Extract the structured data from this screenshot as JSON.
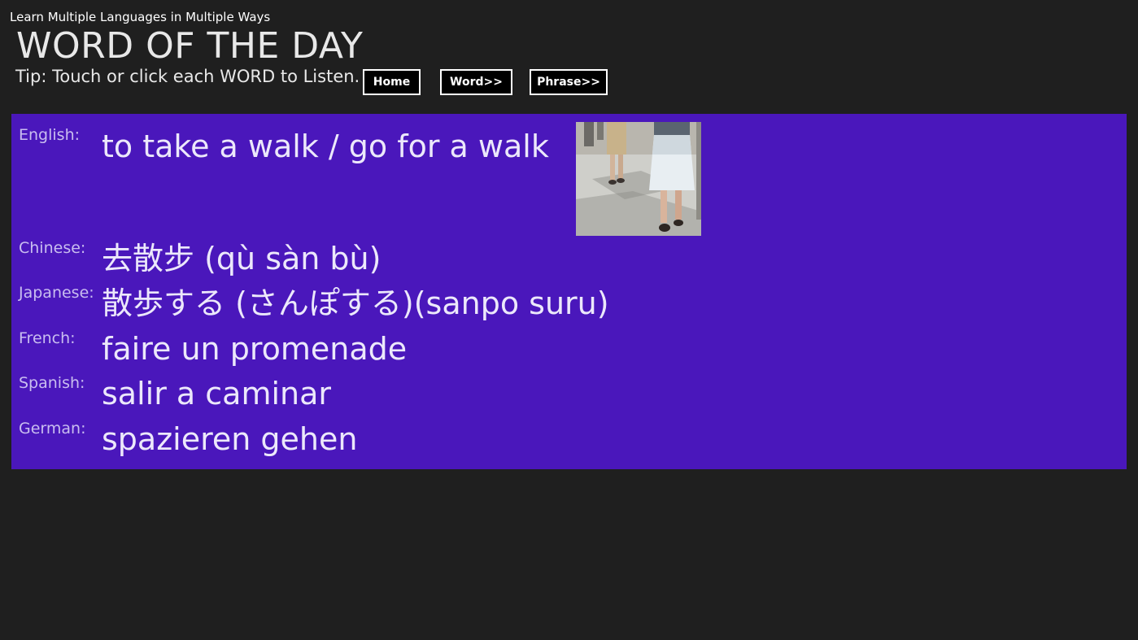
{
  "app": {
    "title": "Learn Multiple Languages in Multiple Ways"
  },
  "header": {
    "title": "WORD OF THE DAY",
    "tip": "Tip: Touch or click each WORD to Listen."
  },
  "nav": {
    "home_label": "Home",
    "word_label": "Word>>",
    "phrase_label": "Phrase>>"
  },
  "word": {
    "rows": [
      {
        "label": "English:",
        "value": "to take a walk / go for a walk"
      },
      {
        "label": "Chinese:",
        "value": "去散步 (qù sàn bù)"
      },
      {
        "label": "Japanese:",
        "value": "散歩する (さんぽする)(sanpo suru)"
      },
      {
        "label": "French:",
        "value": "faire un promenade"
      },
      {
        "label": "Spanish:",
        "value": "salir a caminar"
      },
      {
        "label": "German:",
        "value": "spazieren gehen"
      }
    ]
  },
  "colors": {
    "background": "#1f1f1f",
    "card": "#4a17bb",
    "label": "#c9bdf0",
    "value": "#ece8fb"
  }
}
